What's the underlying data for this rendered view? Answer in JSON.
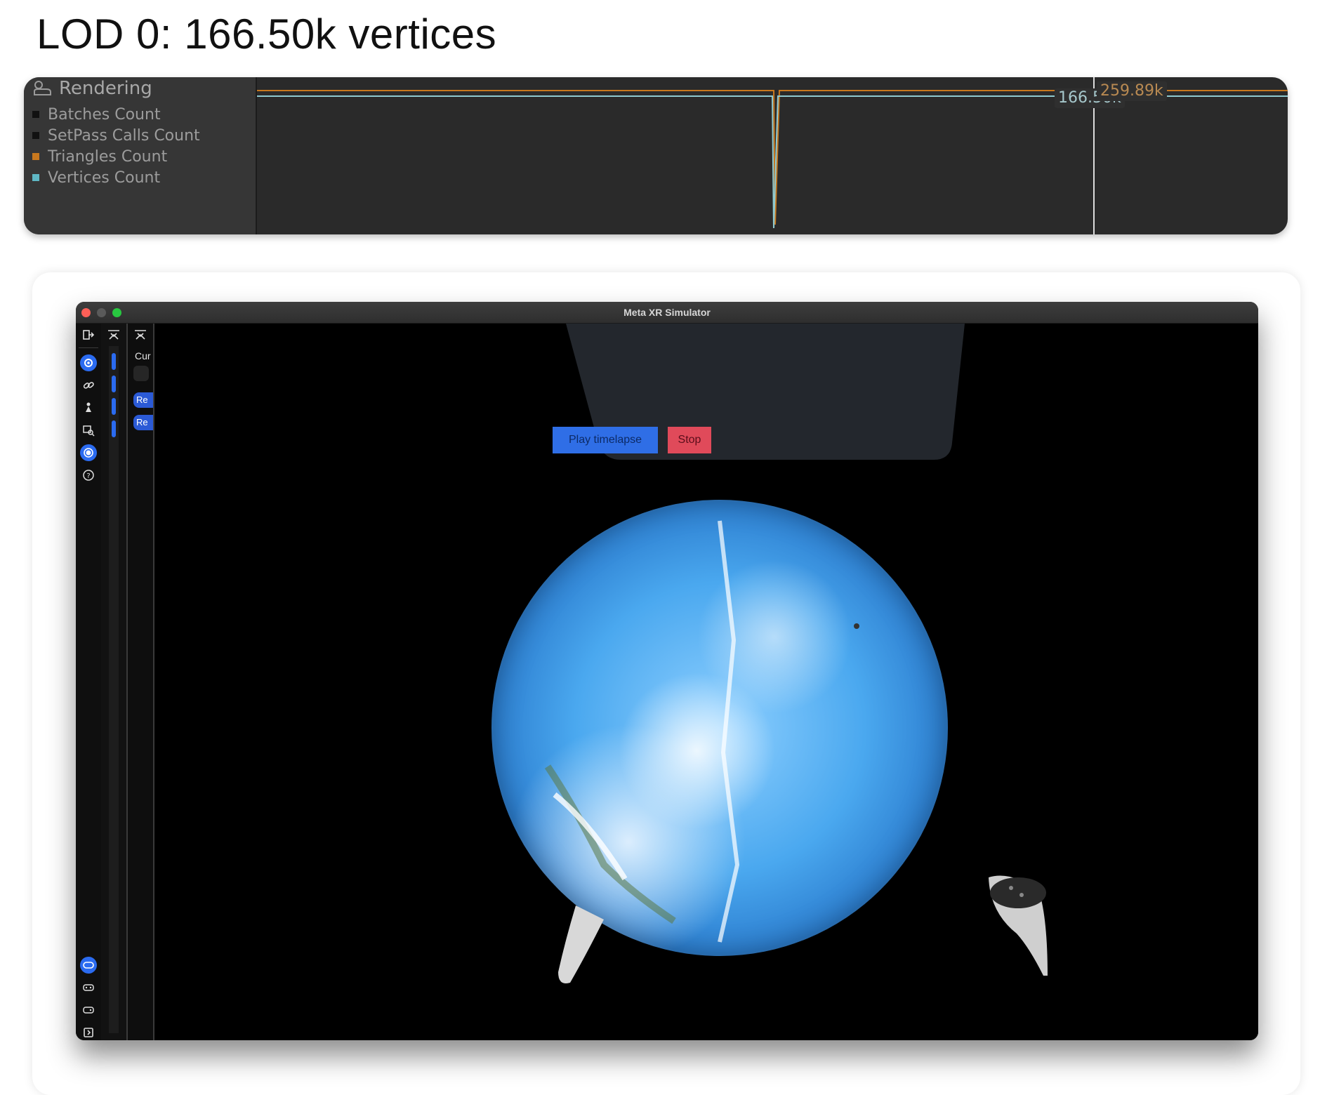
{
  "heading": "LOD 0: 166.50k vertices",
  "profiler": {
    "title": "Rendering",
    "legend": [
      {
        "label": "Batches Count",
        "color": "#111111"
      },
      {
        "label": "SetPass Calls Count",
        "color": "#111111"
      },
      {
        "label": "Triangles Count",
        "color": "#c8781e"
      },
      {
        "label": "Vertices Count",
        "color": "#5fb7c4"
      }
    ],
    "vertices_tag": "166.50k",
    "triangles_tag": "259.89k",
    "colors": {
      "vertices": "#8fc9cf",
      "triangles": "#c8781e"
    }
  },
  "simulator": {
    "window_title": "Meta XR Simulator",
    "panel_label": "Cur",
    "pill_1": "Re",
    "pill_2": "Re",
    "play_button": "Play timelapse",
    "stop_button": "Stop",
    "toolbar_icons": [
      "exit-icon",
      "settings-icon",
      "link-icon",
      "teleport-icon",
      "inspect-icon",
      "record-icon",
      "help-icon",
      "headset-icon",
      "controller-left-icon",
      "controller-right-icon",
      "sidebar-toggle-icon"
    ]
  }
}
